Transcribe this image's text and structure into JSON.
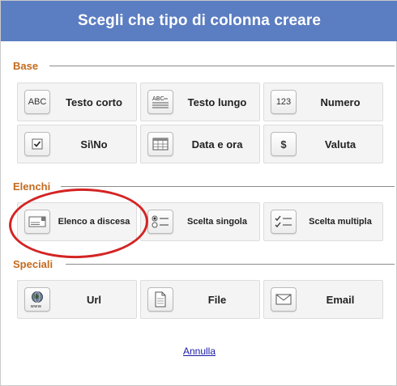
{
  "header": {
    "title": "Scegli che tipo di colonna creare"
  },
  "sections": {
    "base": {
      "label": "Base"
    },
    "elenchi": {
      "label": "Elenchi"
    },
    "speciali": {
      "label": "Speciali"
    }
  },
  "tiles": {
    "testo_corto": {
      "label": "Testo corto",
      "icon": "abc-text-icon",
      "icon_text": "ABC"
    },
    "testo_lungo": {
      "label": "Testo lungo",
      "icon": "long-text-icon",
      "icon_text": "ABC"
    },
    "numero": {
      "label": "Numero",
      "icon": "number-icon",
      "icon_text": "123"
    },
    "si_no": {
      "label": "Si\\No",
      "icon": "checkbox-icon"
    },
    "data_ora": {
      "label": "Data e ora",
      "icon": "calendar-icon"
    },
    "valuta": {
      "label": "Valuta",
      "icon": "dollar-icon",
      "icon_text": "$"
    },
    "elenco_discesa": {
      "label": "Elenco a discesa",
      "icon": "dropdown-list-icon"
    },
    "scelta_singola": {
      "label": "Scelta singola",
      "icon": "radio-list-icon"
    },
    "scelta_multipla": {
      "label": "Scelta multipla",
      "icon": "checklist-icon"
    },
    "url": {
      "label": "Url",
      "icon": "globe-icon",
      "icon_text": "www"
    },
    "file": {
      "label": "File",
      "icon": "document-icon"
    },
    "email": {
      "label": "Email",
      "icon": "envelope-icon"
    }
  },
  "cancel": {
    "label": "Annulla"
  },
  "colors": {
    "header_bg": "#5b7dc1",
    "section_label": "#c46a1c",
    "highlight": "#d42424",
    "link": "#1a1aa6"
  }
}
